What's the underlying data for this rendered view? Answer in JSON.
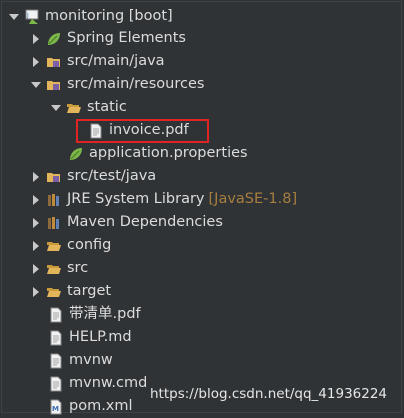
{
  "tree": {
    "project": {
      "label": "monitoring [boot]"
    },
    "spring_elements": {
      "label": "Spring Elements"
    },
    "src_main_java": {
      "label": "src/main/java"
    },
    "src_main_resources": {
      "label": "src/main/resources"
    },
    "static": {
      "label": "static"
    },
    "invoice": {
      "label": "invoice.pdf"
    },
    "application_properties": {
      "label": "application.properties"
    },
    "src_test_java": {
      "label": "src/test/java"
    },
    "jre": {
      "label": "JRE System Library",
      "decoration": "[JavaSE-1.8]"
    },
    "maven": {
      "label": "Maven Dependencies"
    },
    "config": {
      "label": "config"
    },
    "src": {
      "label": "src"
    },
    "target": {
      "label": "target"
    },
    "pdf_cn": {
      "label": "带清单.pdf"
    },
    "help": {
      "label": "HELP.md"
    },
    "mvnw": {
      "label": "mvnw"
    },
    "mvnw_cmd": {
      "label": "mvnw.cmd"
    },
    "pom": {
      "label": "pom.xml"
    }
  },
  "watermark": "https://blog.csdn.net/qq_41936224",
  "colors": {
    "background": "#2f3336",
    "text": "#dcdcdc",
    "decoration": "#a77e3f",
    "highlight": "#e02424",
    "folder": "#e2b55a",
    "spring": "#7db84a"
  }
}
